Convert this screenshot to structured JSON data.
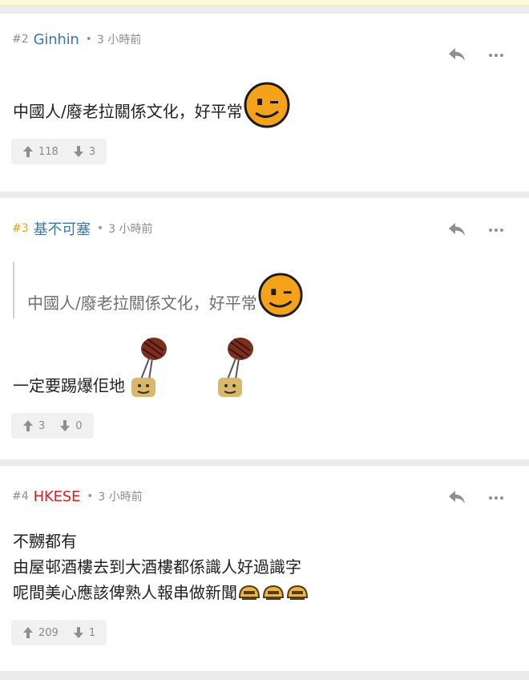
{
  "posts": [
    {
      "number": "#2",
      "username": "Ginhin",
      "time": "3 小時前",
      "content": "中國人/廢老拉關係文化，好平常",
      "upvotes": "118",
      "downvotes": "3"
    },
    {
      "number": "#3",
      "username": "基不可塞",
      "time": "3 小時前",
      "quote": "中國人/廢老拉關係文化，好平常",
      "content": "一定要踢爆佢地",
      "upvotes": "3",
      "downvotes": "0"
    },
    {
      "number": "#4",
      "username": "HKESE",
      "time": "3 小時前",
      "lines": [
        "不嬲都有",
        "由屋邨酒樓去到大酒樓都係識人好過識字",
        "呢間美心應該俾熟人報串做新聞"
      ],
      "upvotes": "209",
      "downvotes": "1"
    }
  ],
  "colors": {
    "username_blue": "#3b76a9",
    "username_red": "#d31f1f",
    "post_number_gold": "#e6a500"
  },
  "icons": [
    "reply-icon",
    "more-icon",
    "upvote-icon",
    "downvote-icon",
    "wink-emoji",
    "hammer-emoji",
    "fist-emoji"
  ]
}
